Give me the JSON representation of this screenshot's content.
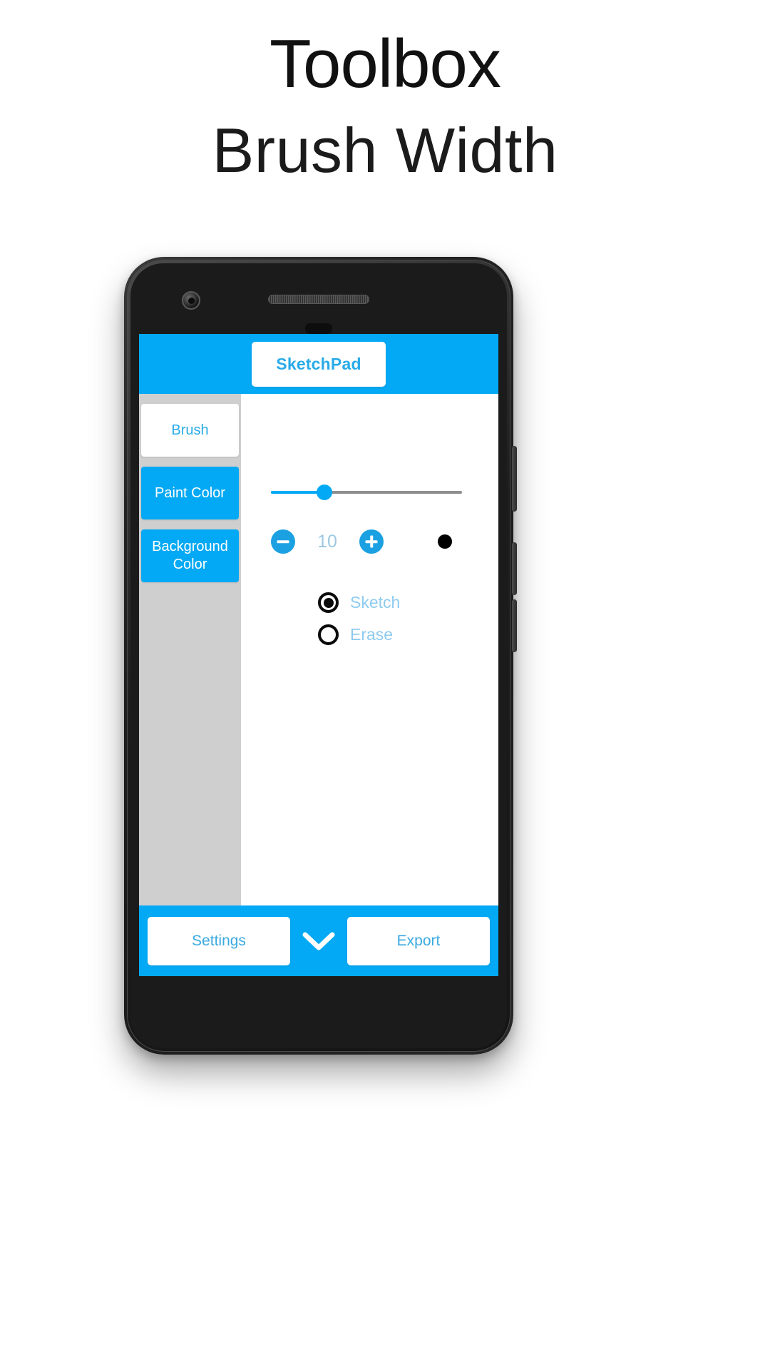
{
  "promo": {
    "title": "Toolbox",
    "subtitle": "Brush Width"
  },
  "colors": {
    "accent": "#03a9f4",
    "accent_text": "#29abe8",
    "label_blue": "#8ecbf0",
    "sidebar_bg": "#cfcfcf",
    "value_blue": "#9ec9e3",
    "brush_preview": "#000000",
    "slider_track": "#8e8e8e"
  },
  "app": {
    "header": {
      "title": "SketchPad"
    },
    "sidebar": {
      "items": [
        {
          "label": "Brush",
          "state": "active"
        },
        {
          "label": "Paint Color",
          "state": "plain"
        },
        {
          "label": "Background Color",
          "state": "plain"
        }
      ]
    },
    "brush_panel": {
      "slider": {
        "name": "brush-width-slider",
        "value": 10,
        "min": 1,
        "max": 36,
        "fill_percent": 28
      },
      "stepper": {
        "decrement_label": "−",
        "increment_label": "+",
        "value": "10"
      },
      "preview_dot_label": "brush preview",
      "modes": [
        {
          "label": "Sketch",
          "selected": true
        },
        {
          "label": "Erase",
          "selected": false
        }
      ]
    },
    "bottom_bar": {
      "settings_label": "Settings",
      "expand_icon": "chevron-down-icon",
      "export_label": "Export"
    }
  }
}
